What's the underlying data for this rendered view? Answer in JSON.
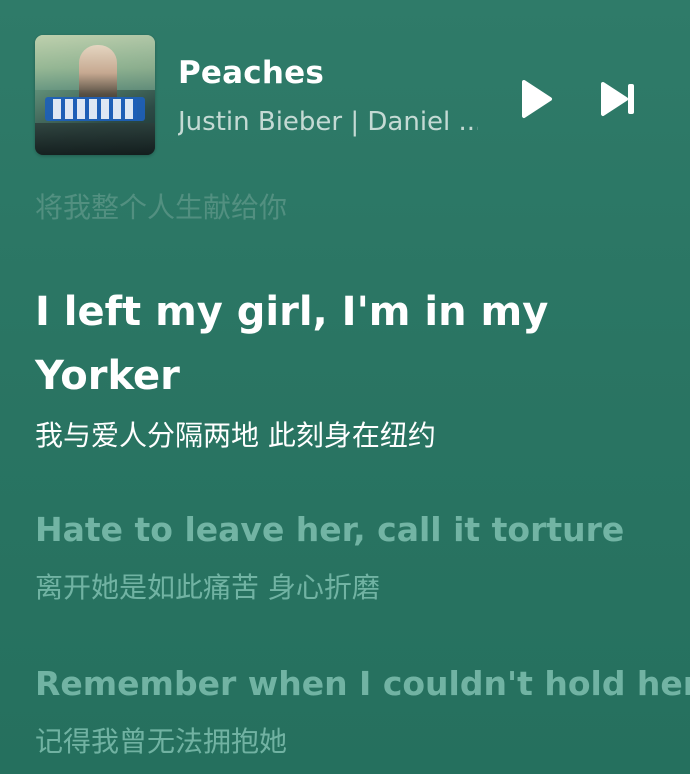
{
  "now_playing": {
    "cover_icon": "album-cover",
    "title": "Peaches",
    "artist": "Justin Bieber | Daniel ...",
    "controls": {
      "play_icon": "play-icon",
      "next_icon": "skip-forward-icon"
    }
  },
  "lyrics": {
    "previous_translation": "将我整个人生献给你",
    "active_line": "I left my girl, I'm in my Yorker",
    "active_translation": "我与爱人分隔两地 此刻身在纽约",
    "upcoming": [
      {
        "line": "Hate to leave her, call it torture",
        "translation": "离开她是如此痛苦 身心折磨"
      },
      {
        "line": "Remember when I couldn't hold her",
        "translation": "记得我曾无法拥抱她"
      }
    ]
  },
  "colors": {
    "background_top": "#2f7b69",
    "background_bottom": "#25705e",
    "active_text": "#ffffff",
    "inactive_text": "#a0dccd"
  }
}
